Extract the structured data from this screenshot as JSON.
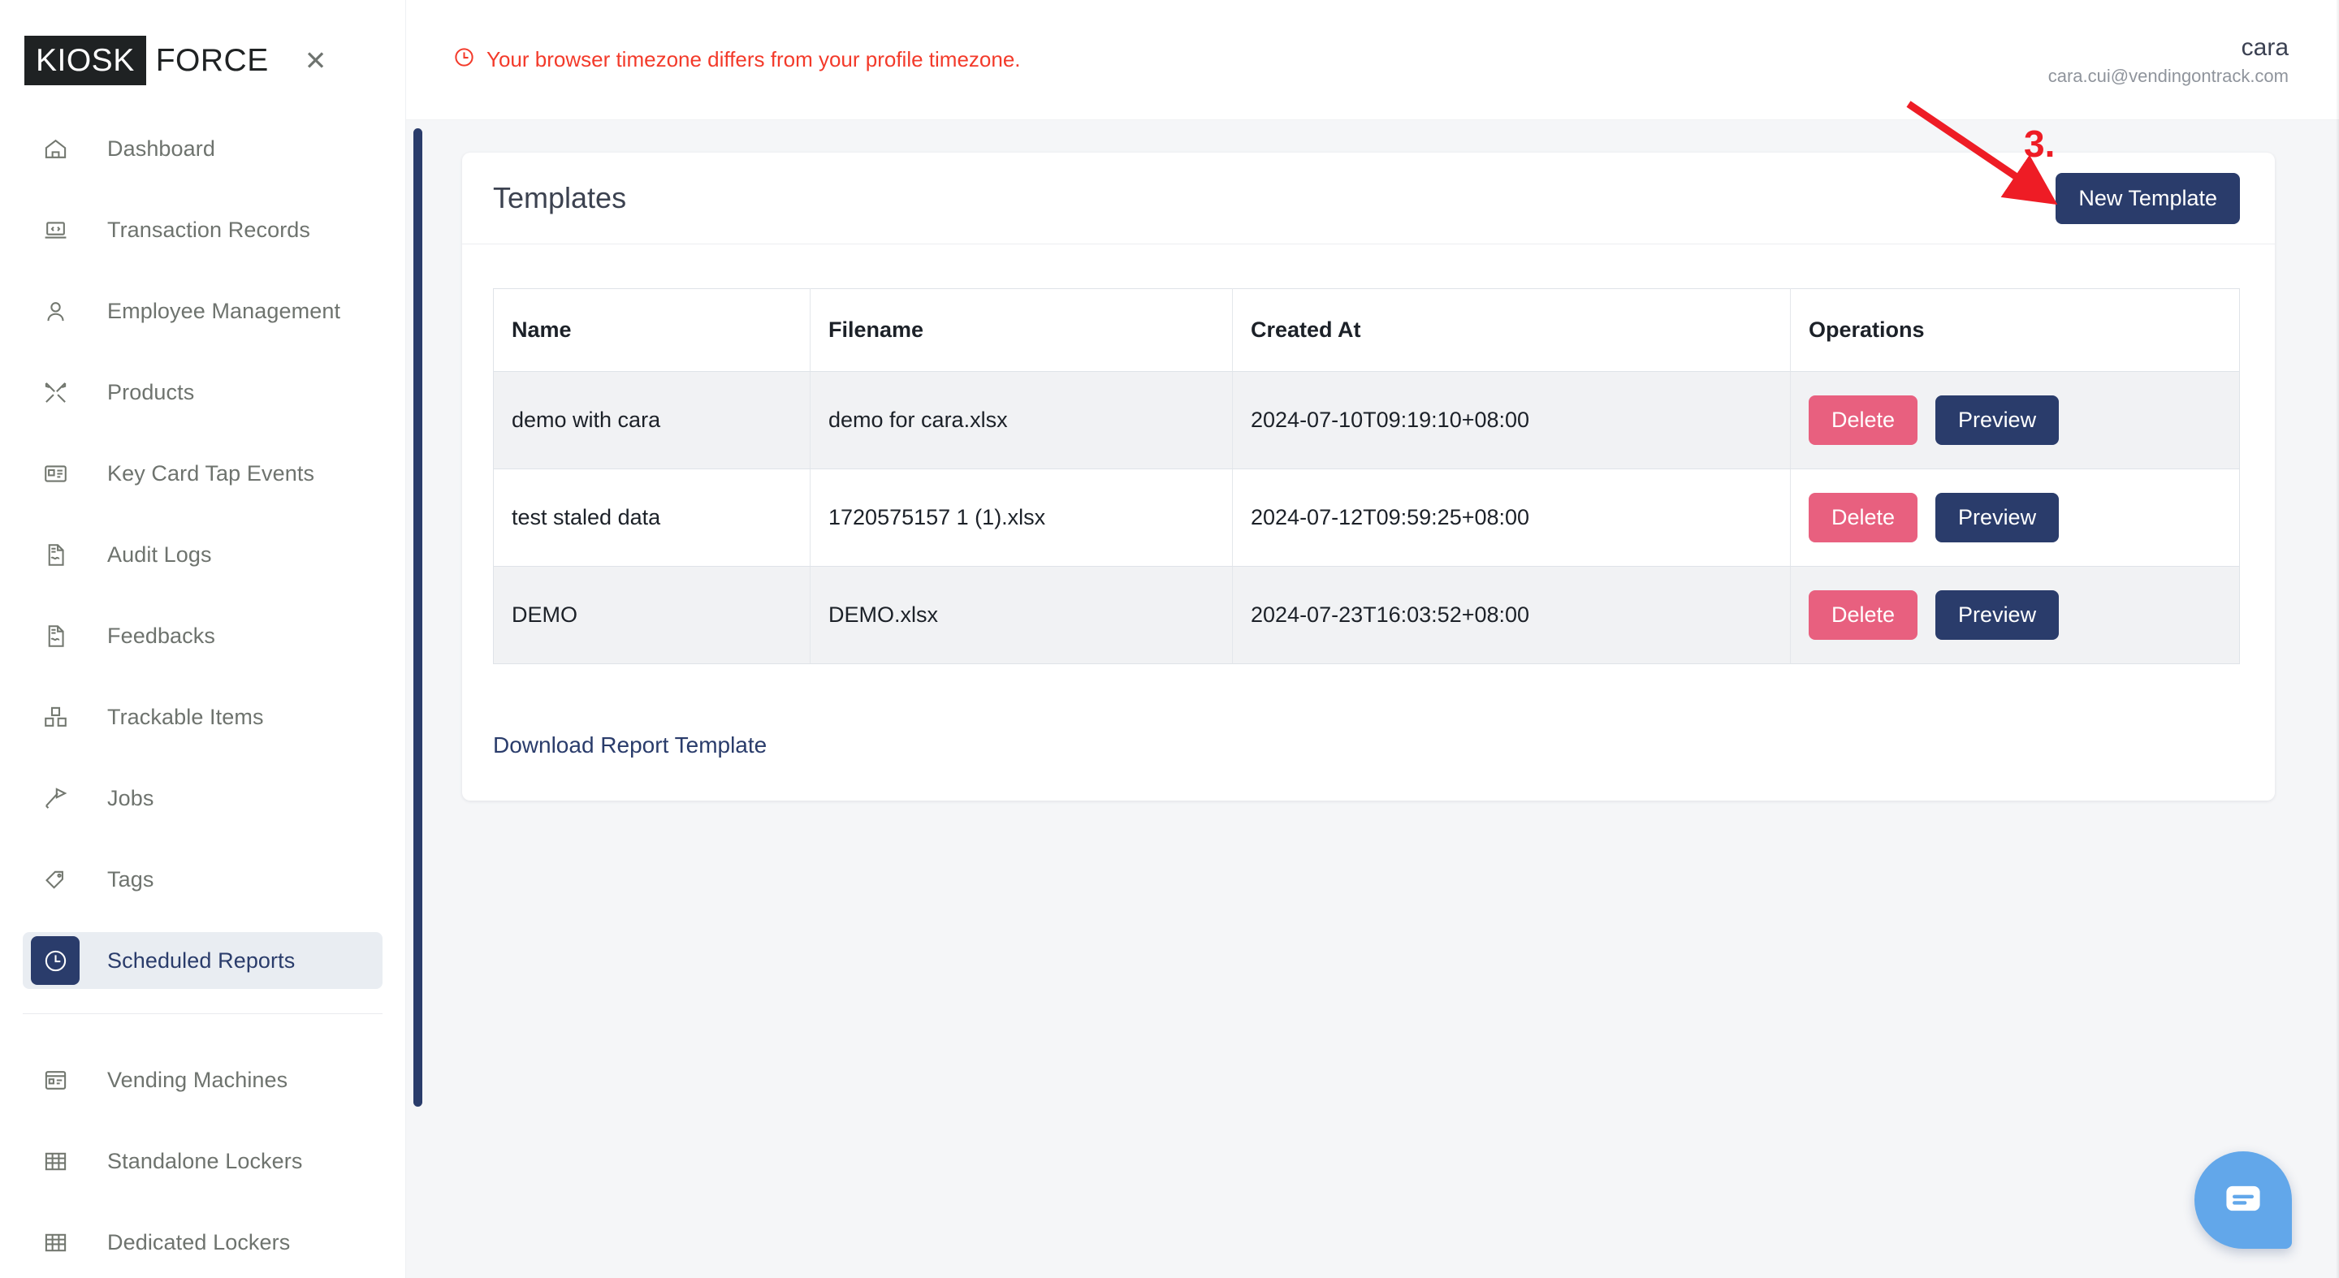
{
  "brand": {
    "mark": "KIOSK",
    "word": "FORCE",
    "close_icon": "close-icon"
  },
  "sidebar": {
    "items": [
      {
        "label": "Dashboard",
        "icon": "home-icon",
        "active": false
      },
      {
        "label": "Transaction Records",
        "icon": "laptop-code-icon",
        "active": false
      },
      {
        "label": "Employee Management",
        "icon": "user-icon",
        "active": false
      },
      {
        "label": "Products",
        "icon": "tools-icon",
        "active": false
      },
      {
        "label": "Key Card Tap Events",
        "icon": "id-card-icon",
        "active": false
      },
      {
        "label": "Audit Logs",
        "icon": "document-signature-icon",
        "active": false
      },
      {
        "label": "Feedbacks",
        "icon": "document-signature-icon",
        "active": false
      },
      {
        "label": "Trackable Items",
        "icon": "boxes-icon",
        "active": false
      },
      {
        "label": "Jobs",
        "icon": "hammer-icon",
        "active": false
      },
      {
        "label": "Tags",
        "icon": "tag-icon",
        "active": false
      },
      {
        "label": "Scheduled Reports",
        "icon": "clock-icon",
        "active": true
      }
    ],
    "items_secondary": [
      {
        "label": "Vending Machines",
        "icon": "vending-machine-icon",
        "active": false
      },
      {
        "label": "Standalone Lockers",
        "icon": "grid-icon",
        "active": false
      },
      {
        "label": "Dedicated Lockers",
        "icon": "grid-icon",
        "active": false
      }
    ]
  },
  "topbar": {
    "timezone_warning": "Your browser timezone differs from your profile timezone.",
    "warning_icon": "clock-icon",
    "user_name": "cara",
    "user_email": "cara.cui@vendingontrack.com"
  },
  "card": {
    "title": "Templates",
    "new_template_label": "New Template",
    "download_link": "Download Report Template"
  },
  "table": {
    "columns": [
      "Name",
      "Filename",
      "Created At",
      "Operations"
    ],
    "rows": [
      {
        "name": "demo with cara",
        "filename": "demo for cara.xlsx",
        "created_at": "2024-07-10T09:19:10+08:00",
        "delete_label": "Delete",
        "preview_label": "Preview"
      },
      {
        "name": "test staled data",
        "filename": "1720575157 1 (1).xlsx",
        "created_at": "2024-07-12T09:59:25+08:00",
        "delete_label": "Delete",
        "preview_label": "Preview"
      },
      {
        "name": "DEMO",
        "filename": "DEMO.xlsx",
        "created_at": "2024-07-23T16:03:52+08:00",
        "delete_label": "Delete",
        "preview_label": "Preview"
      }
    ]
  },
  "annotation": {
    "step_number": "3.",
    "color": "#ee1c25"
  },
  "chat": {
    "icon": "chat-bubble-icon"
  },
  "colors": {
    "navy": "#2a3c6b",
    "delete_pink": "#e8607f",
    "warning_red": "#f33a2a",
    "chat_blue": "#62a7ea",
    "sidebar_active_bg": "#e9edf2"
  }
}
